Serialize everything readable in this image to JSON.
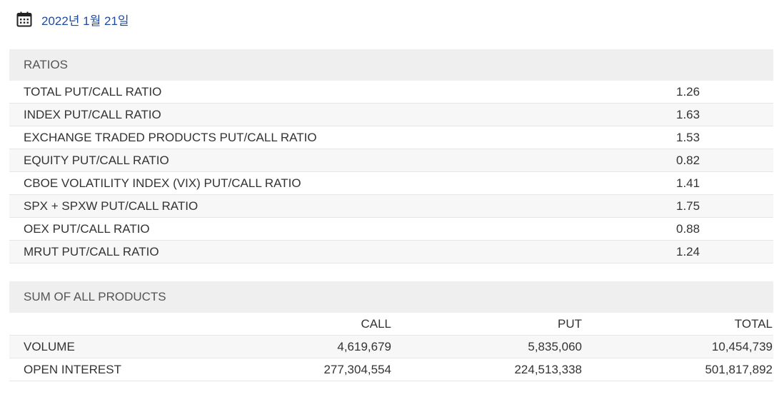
{
  "date": {
    "icon": "calendar-icon",
    "label": "2022년 1월 21일",
    "color": "#1e4a9e"
  },
  "ratios": {
    "header": "RATIOS",
    "rows": [
      {
        "label": "TOTAL PUT/CALL RATIO",
        "value": "1.26"
      },
      {
        "label": "INDEX PUT/CALL RATIO",
        "value": "1.63"
      },
      {
        "label": "EXCHANGE TRADED PRODUCTS PUT/CALL RATIO",
        "value": "1.53"
      },
      {
        "label": "EQUITY PUT/CALL RATIO",
        "value": "0.82"
      },
      {
        "label": "CBOE VOLATILITY INDEX (VIX) PUT/CALL RATIO",
        "value": "1.41"
      },
      {
        "label": "SPX + SPXW PUT/CALL RATIO",
        "value": "1.75"
      },
      {
        "label": "OEX PUT/CALL RATIO",
        "value": "0.88"
      },
      {
        "label": "MRUT PUT/CALL RATIO",
        "value": "1.24"
      }
    ]
  },
  "sums": {
    "header": "SUM OF ALL PRODUCTS",
    "columns": {
      "call": "CALL",
      "put": "PUT",
      "total": "TOTAL"
    },
    "rows": [
      {
        "label": "VOLUME",
        "call": "4,619,679",
        "put": "5,835,060",
        "total": "10,454,739"
      },
      {
        "label": "OPEN INTEREST",
        "call": "277,304,554",
        "put": "224,513,338",
        "total": "501,817,892"
      }
    ]
  }
}
